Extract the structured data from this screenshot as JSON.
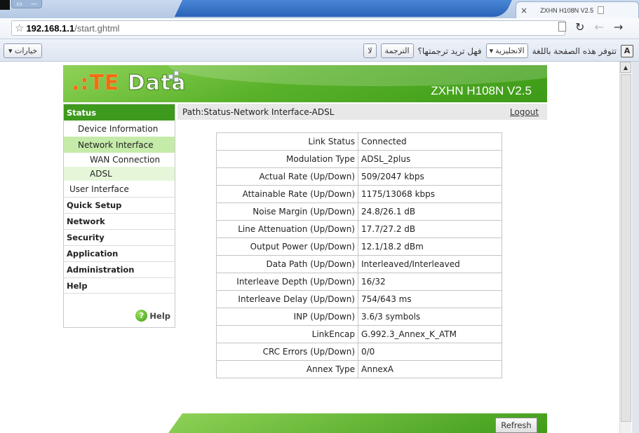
{
  "browser": {
    "tab_title": "ZXHN H108N V2.5",
    "tab_close": "×",
    "url_host": "192.168.1.1",
    "url_path": "/start.ghtml"
  },
  "translate_bar": {
    "options_label": "خيارات ▾",
    "prompt_text": "تتوفر هذه الصفحة باللغة",
    "language": "الانجليزية",
    "question": "فهل تريد ترجمتها؟",
    "translate_button": "الترجمة",
    "no_button": "لا"
  },
  "router": {
    "logo_te": ".:TE",
    "logo_data": "Data",
    "model": "ZXHN H108N V2.5",
    "path": "Path:Status-Network Interface-ADSL",
    "logout": "Logout",
    "refresh": "Refresh",
    "help": "Help"
  },
  "sidebar": {
    "status": "Status",
    "device_information": "Device Information",
    "network_interface": "Network Interface",
    "wan_connection": "WAN Connection",
    "adsl": "ADSL",
    "user_interface": "User Interface",
    "quick_setup": "Quick Setup",
    "network": "Network",
    "security": "Security",
    "application": "Application",
    "administration": "Administration",
    "help": "Help"
  },
  "adsl_info": [
    {
      "label": "Link Status",
      "value": "Connected"
    },
    {
      "label": "Modulation Type",
      "value": "ADSL_2plus"
    },
    {
      "label": "Actual Rate (Up/Down)",
      "value": "509/2047 kbps"
    },
    {
      "label": "Attainable Rate (Up/Down)",
      "value": "1175/13068 kbps"
    },
    {
      "label": "Noise Margin (Up/Down)",
      "value": "24.8/26.1 dB"
    },
    {
      "label": "Line Attenuation (Up/Down)",
      "value": "17.7/27.2 dB"
    },
    {
      "label": "Output Power (Up/Down)",
      "value": "12.1/18.2 dBm"
    },
    {
      "label": "Data Path (Up/Down)",
      "value": "Interleaved/Interleaved"
    },
    {
      "label": "Interleave Depth (Up/Down)",
      "value": "16/32"
    },
    {
      "label": "Interleave Delay (Up/Down)",
      "value": "754/643 ms"
    },
    {
      "label": "INP (Up/Down)",
      "value": "3.6/3 symbols"
    },
    {
      "label": "LinkEncap",
      "value": "G.992.3_Annex_K_ATM"
    },
    {
      "label": "CRC Errors (Up/Down)",
      "value": "0/0"
    },
    {
      "label": "Annex Type",
      "value": "AnnexA"
    }
  ]
}
